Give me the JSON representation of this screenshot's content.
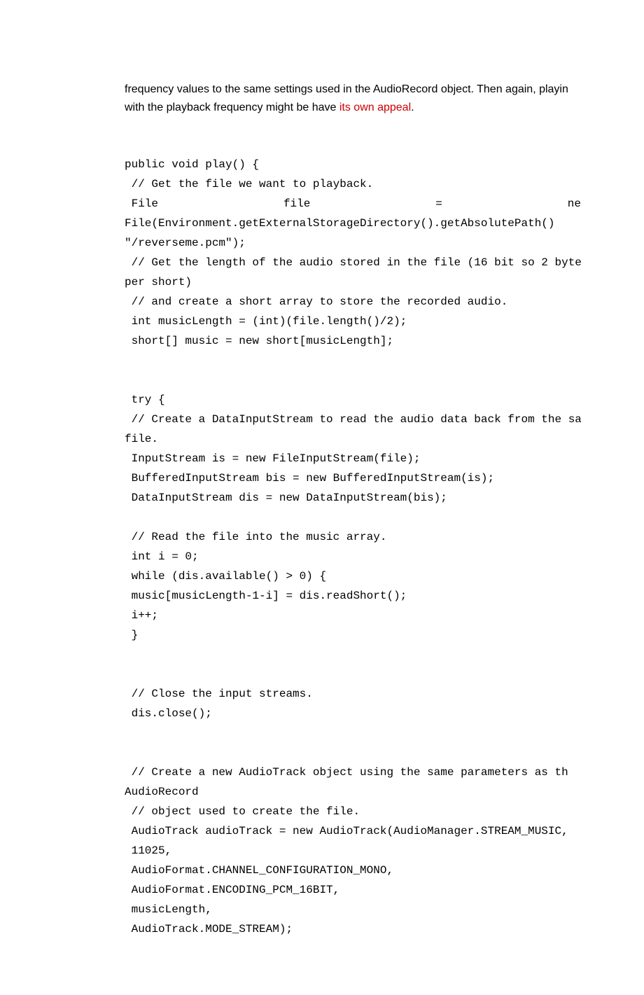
{
  "prose": {
    "line1_a": "frequency values to the same settings used in the AudioRecord object. Then again, playin",
    "line2_a": "with the playback frequency might be have ",
    "link_text": "its own appeal",
    "line2_b": "."
  },
  "code": {
    "l1": "public void play() {",
    "l2": " // Get the file we want to playback.",
    "l3_a": " File",
    "l3_b": "file",
    "l3_c": "=",
    "l3_d": "ne",
    "l4": "File(Environment.getExternalStorageDirectory().getAbsolutePath()  ",
    "l5": "\"/reverseme.pcm\");",
    "l6": " // Get the length of the audio stored in the file (16 bit so 2 byte",
    "l7": "per short)",
    "l8": " // and create a short array to store the recorded audio.",
    "l9": " int musicLength = (int)(file.length()/2);",
    "l10": " short[] music = new short[musicLength];",
    "blank": "",
    "l11": " try {",
    "l12": " // Create a DataInputStream to read the audio data back from the save",
    "l13": "file.",
    "l14": " InputStream is = new FileInputStream(file);",
    "l15": " BufferedInputStream bis = new BufferedInputStream(is);",
    "l16": " DataInputStream dis = new DataInputStream(bis);",
    "l17": " // Read the file into the music array.",
    "l18": " int i = 0;",
    "l19": " while (dis.available() > 0) {",
    "l20": " music[musicLength-1-i] = dis.readShort();",
    "l21": " i++;",
    "l22": " }",
    "l23": " // Close the input streams.",
    "l24": " dis.close();",
    "l25": " // Create a new AudioTrack object using the same parameters as th",
    "l26": "AudioRecord",
    "l27": " // object used to create the file.",
    "l28": " AudioTrack audioTrack = new AudioTrack(AudioManager.STREAM_MUSIC,",
    "l29": " 11025,",
    "l30": " AudioFormat.CHANNEL_CONFIGURATION_MONO,",
    "l31": " AudioFormat.ENCODING_PCM_16BIT,",
    "l32": " musicLength,",
    "l33": " AudioTrack.MODE_STREAM);"
  }
}
